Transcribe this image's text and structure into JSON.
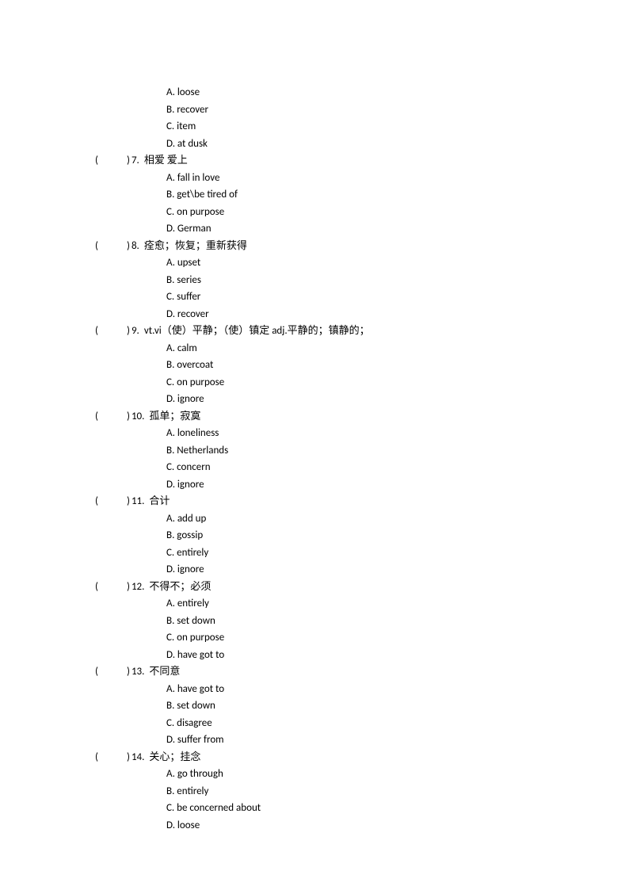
{
  "orphan_options": [
    "A. loose",
    "B. recover",
    "C. item",
    "D. at dusk"
  ],
  "questions": [
    {
      "num": "7.",
      "prompt": "相爱 爱上",
      "options": [
        "A. fall in love",
        "B. get\\be tired of",
        "C. on purpose",
        "D. German"
      ]
    },
    {
      "num": "8.",
      "prompt": " 痊愈；恢复；重新获得",
      "options": [
        "A. upset",
        "B. series",
        "C. suffer",
        "D. recover"
      ]
    },
    {
      "num": "9.",
      "prompt": "  vt.vi（使）平静；（使）镇定  adj.平静的；镇静的；",
      "options": [
        "A. calm",
        "B. overcoat",
        "C. on purpose",
        "D. ignore"
      ]
    },
    {
      "num": "10.",
      "prompt": " 孤单；寂寞",
      "options": [
        "A. loneliness",
        "B. Netherlands",
        "C. concern",
        "D. ignore"
      ]
    },
    {
      "num": "11.",
      "prompt": " 合计",
      "options": [
        "A. add up",
        "B. gossip",
        "C. entirely",
        "D. ignore"
      ]
    },
    {
      "num": "12.",
      "prompt": " 不得不；必须",
      "options": [
        "A. entirely",
        "B. set down",
        "C. on purpose",
        "D. have got to"
      ]
    },
    {
      "num": "13.",
      "prompt": " 不同意",
      "options": [
        "A. have got to",
        "B. set down",
        "C. disagree",
        "D. suffer from"
      ]
    },
    {
      "num": "14.",
      "prompt": " 关心；挂念",
      "options": [
        "A. go through",
        "B. entirely",
        "C. be concerned about",
        "D. loose"
      ]
    }
  ],
  "paren_open": "(",
  "paren_close": ")"
}
